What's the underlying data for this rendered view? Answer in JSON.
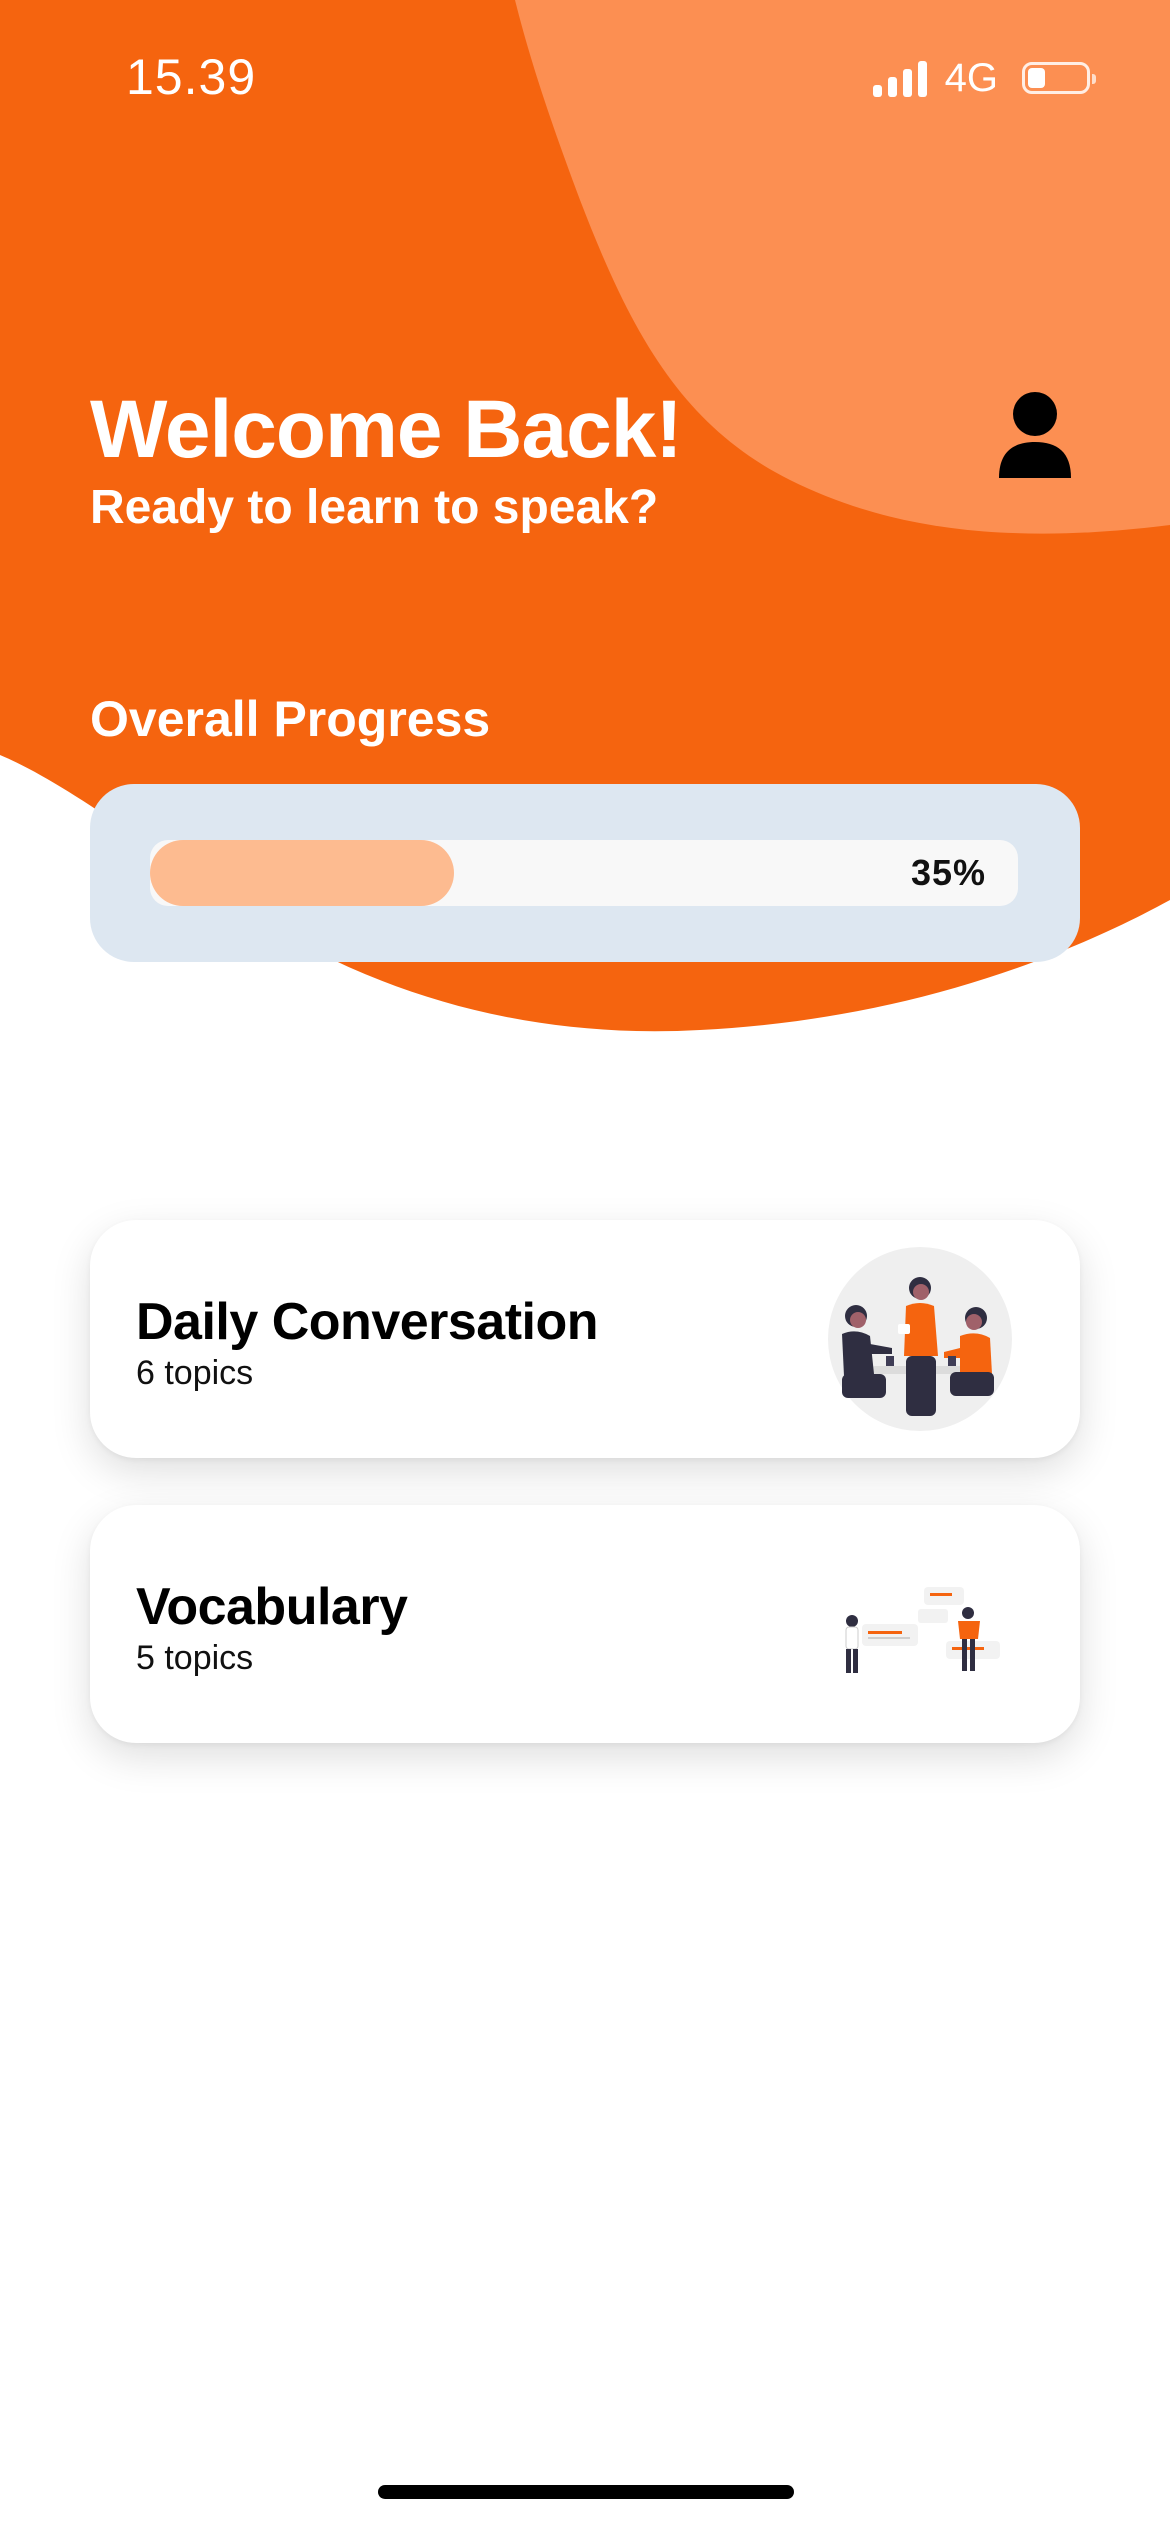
{
  "status_bar": {
    "time": "15.39",
    "network": "4G",
    "battery_level": 0.3
  },
  "header": {
    "title": "Welcome Back!",
    "subtitle": "Ready to learn to speak?",
    "profile_icon": "person-icon"
  },
  "progress": {
    "label": "Overall Progress",
    "percent": 35,
    "percent_text": "35%"
  },
  "topics": [
    {
      "title": "Daily Conversation",
      "count_text": "6 topics",
      "illustration": "conversation-illustration"
    },
    {
      "title": "Vocabulary",
      "count_text": "5 topics",
      "illustration": "vocabulary-illustration"
    }
  ],
  "colors": {
    "brand_orange": "#f5640f",
    "light_orange": "#fc8f52",
    "progress_fill": "#fdbb90",
    "progress_card": "#dde7f1"
  }
}
